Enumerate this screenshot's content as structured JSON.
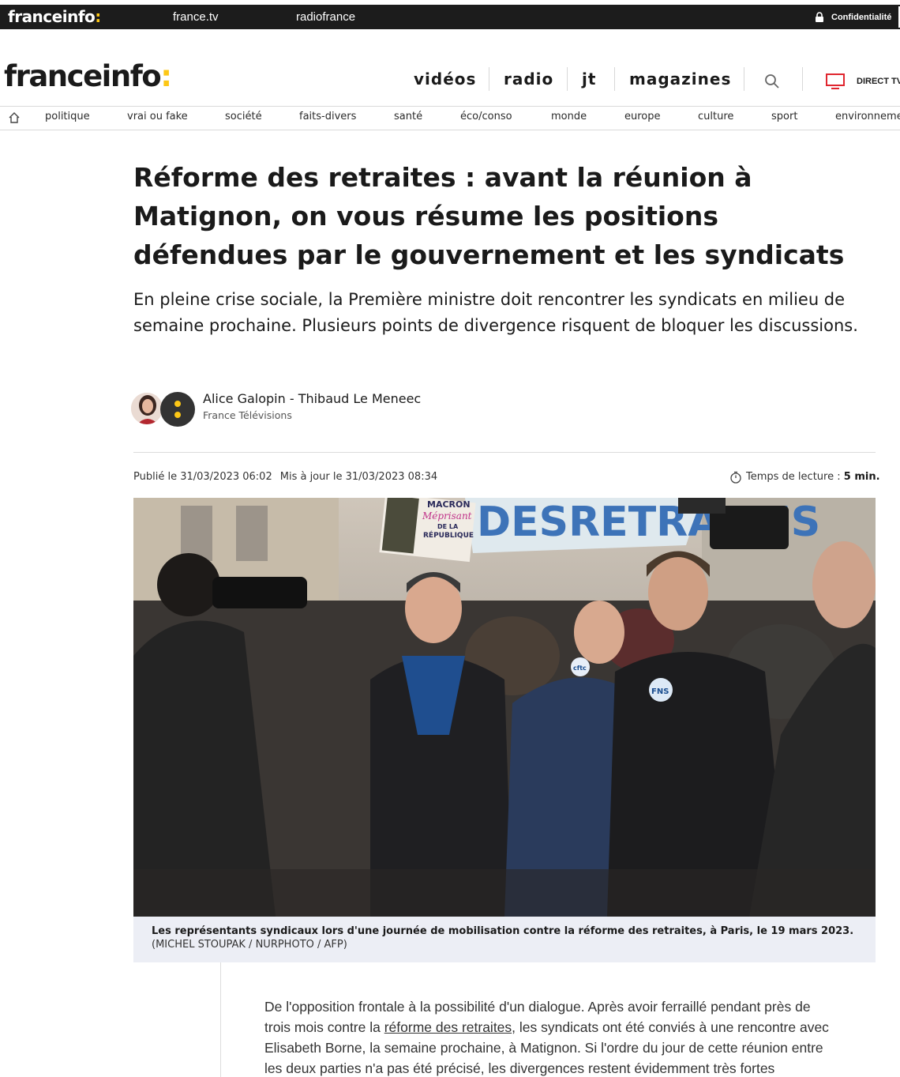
{
  "topbar": {
    "logo_main": "franceinfo",
    "logo_colon": ":",
    "link_francetv": "france.tv",
    "link_radiofrance": "radiofrance",
    "confidentiality": "Confidentialité"
  },
  "header": {
    "logo_main": "franceinfo",
    "logo_colon": ":",
    "nav": [
      "vidéos",
      "radio",
      "jt",
      "magazines"
    ],
    "directtv": "DIRECT TV"
  },
  "categories": [
    "politique",
    "vrai ou fake",
    "société",
    "faits-divers",
    "santé",
    "éco/conso",
    "monde",
    "europe",
    "culture",
    "sport",
    "environneme"
  ],
  "article": {
    "title": "Réforme des retraites : avant la réunion à Matignon, on vous résume les positions défendues par le gouvernement et les syndicats",
    "lead": "En pleine crise sociale, la Première ministre doit rencontrer les syndicats en milieu de semaine prochaine. Plusieurs points de divergence risquent de bloquer les discussions.",
    "authors": "Alice Galopin - Thibaud Le Meneec",
    "organization": "France Télévisions",
    "published": "Publié le 31/03/2023 06:02",
    "updated": "Mis à jour le 31/03/2023 08:34",
    "reading_label": "Temps de lecture :",
    "reading_value": "5 min.",
    "photo_signs": {
      "sign_line1": "MACRON",
      "sign_line2": "Méprisant",
      "sign_line3": "DE LA",
      "sign_line4": "RÉPUBLIQUE",
      "banner": "DESRETRAITES",
      "badge1": "cftc",
      "badge2": "FNS"
    },
    "caption_bold": "Les représentants syndicaux lors d'une journée de mobilisation contre la réforme des retraites, à Paris, le 19 mars 2023.",
    "caption_credit": "(MICHEL STOUPAK / NURPHOTO / AFP)",
    "body_before_link": "De l'opposition frontale à la possibilité d'un dialogue. Après avoir ferraillé pendant près de trois mois contre la ",
    "body_link": "réforme des retraites",
    "body_after_link": ", les syndicats ont été conviés à une rencontre avec Elisabeth Borne, la semaine prochaine, à Matignon. Si l'ordre du jour de cette réunion entre les deux parties n'a pas été précisé, les divergences restent évidemment très fortes"
  },
  "colors": {
    "brand_yellow": "#fdc716",
    "topbar_bg": "#1c1c1c",
    "caption_bg": "#eceef5",
    "tv_icon_red": "#e0262f"
  }
}
